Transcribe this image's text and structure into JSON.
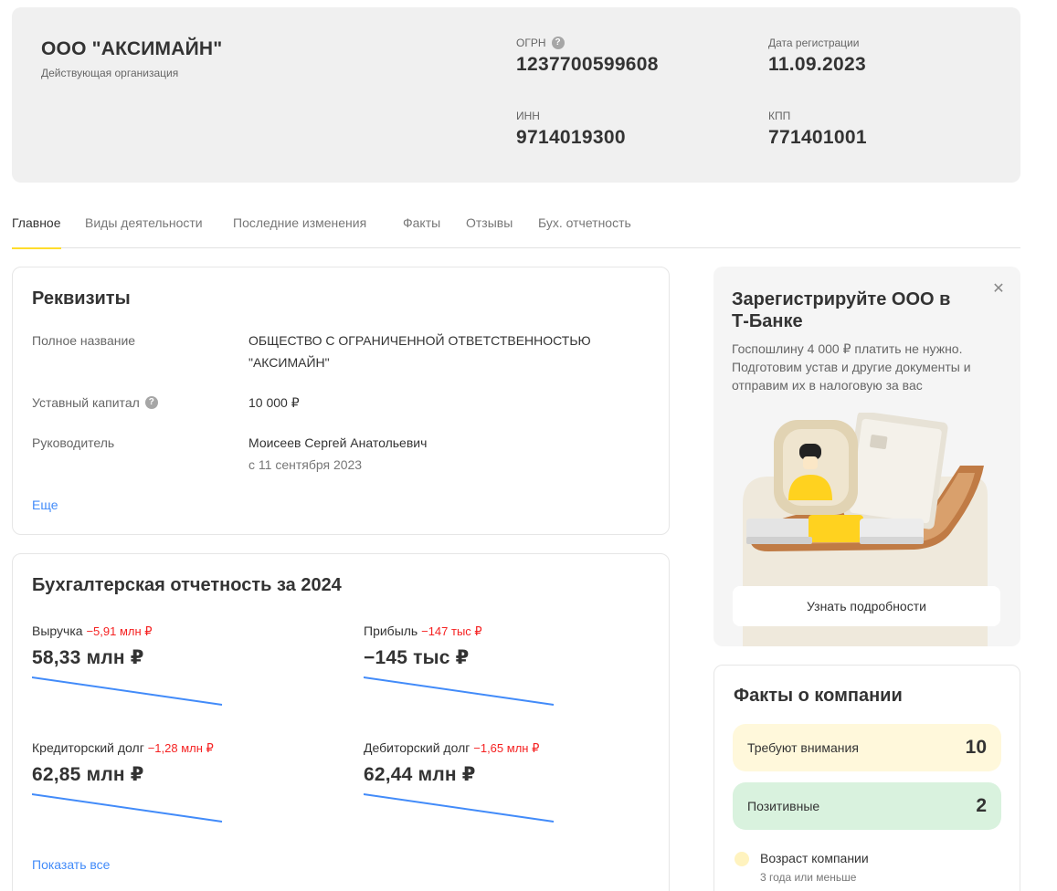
{
  "company": {
    "name": "ООО \"АКСИМАЙН\"",
    "status": "Действующая организация",
    "fields": {
      "ogrn": {
        "label": "ОГРН",
        "value": "1237700599608"
      },
      "reg_date": {
        "label": "Дата регистрации",
        "value": "11.09.2023"
      },
      "inn": {
        "label": "ИНН",
        "value": "9714019300"
      },
      "kpp": {
        "label": "КПП",
        "value": "771401001"
      }
    },
    "help_glyph": "?"
  },
  "tabs": [
    "Главное",
    "Виды деятельности",
    "Последние изменения",
    "Факты",
    "Отзывы",
    "Бух. отчетность"
  ],
  "active_tab": "Главное",
  "requisites": {
    "title": "Реквизиты",
    "full_name_label": "Полное название",
    "full_name_value": "ОБЩЕСТВО С ОГРАНИЧЕННОЙ ОТВЕТСТВЕННОСТЬЮ \"АКСИМАЙН\"",
    "capital_label": "Уставный капитал",
    "capital_value": "10 000 ₽",
    "head_label": "Руководитель",
    "head_value": "Моисеев Сергей Анатольевич",
    "head_since": "с 11 сентября 2023",
    "more_link": "Еще"
  },
  "finance": {
    "title": "Бухгалтерская отчетность за 2024",
    "items": [
      {
        "label": "Выручка",
        "delta": "−5,91 млн ₽",
        "value": "58,33 млн ₽"
      },
      {
        "label": "Прибыль",
        "delta": "−147 тыс ₽",
        "value": "−145 тыс ₽"
      },
      {
        "label": "Кредиторский долг",
        "delta": "−1,28 млн ₽",
        "value": "62,85 млн ₽"
      },
      {
        "label": "Дебиторский долг",
        "delta": "−1,65 млн ₽",
        "value": "62,44 млн ₽"
      }
    ],
    "show_all": "Показать все",
    "trend_color": "#428bf9",
    "delta_color": "#f52222"
  },
  "promo": {
    "title": "Зарегистрируйте ООО в Т-Банке",
    "text": "Госпошлину 4 000 ₽ платить не нужно. Подготовим устав и другие документы и отправим их в налоговую за вас",
    "button": "Узнать подробности",
    "close_icon": "close-icon",
    "close_glyph": "✕"
  },
  "facts": {
    "title": "Факты о компании",
    "attention_label": "Требуют внимания",
    "attention_count": "10",
    "positive_label": "Позитивные",
    "positive_count": "2",
    "age_label": "Возраст компании",
    "age_value": "3 года или меньше",
    "colors": {
      "attention": "#fff8db",
      "positive": "#d9f2de",
      "dot": "#fff3bf"
    }
  },
  "colors": {
    "accent": "#ffdd2d",
    "link": "#428bf9",
    "header_bg": "#f0f0f0"
  }
}
